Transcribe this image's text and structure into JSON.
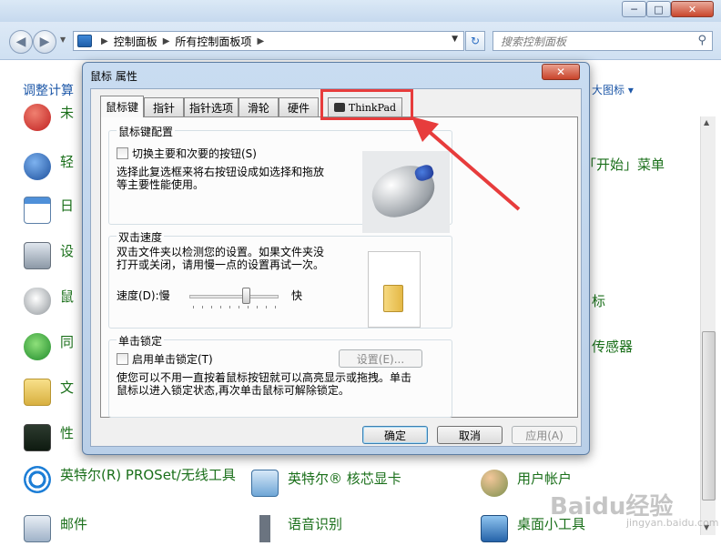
{
  "window": {
    "buttons": {
      "minimize": "─",
      "maximize": "□",
      "close": "✕"
    }
  },
  "addressbar": {
    "crumbs": [
      "控制面板",
      "所有控制面板项"
    ],
    "search_placeholder": "搜索控制面板"
  },
  "header": {
    "left": "调整计算",
    "right": "大图标 ▾"
  },
  "items": [
    {
      "label": "未",
      "icon": "red-circle-icon"
    },
    {
      "label": "轻",
      "icon": "accessibility-icon"
    },
    {
      "label": "日",
      "icon": "calendar-icon"
    },
    {
      "label": "设",
      "icon": "printer-icon"
    },
    {
      "label": "鼠",
      "icon": "mouse-icon"
    },
    {
      "label": "同",
      "icon": "sync-icon"
    },
    {
      "label": "文",
      "icon": "folder-options-icon"
    },
    {
      "label": "性",
      "icon": "performance-icon"
    },
    {
      "label": "英特尔(R) PROSet/无线工具",
      "icon": "wifi-icon"
    },
    {
      "label": "邮件",
      "icon": "mail-icon"
    }
  ],
  "items_mid": [
    {
      "label": "英特尔® 核芯显卡",
      "icon": "intel-graphics-icon"
    },
    {
      "label": "语音识别",
      "icon": "microphone-icon"
    }
  ],
  "items_right": [
    {
      "label": "「开始」菜单"
    },
    {
      "label": "标"
    },
    {
      "label": "传感器"
    },
    {
      "label": "用户帐户",
      "icon": "users-icon"
    },
    {
      "label": "桌面小工具",
      "icon": "gadgets-icon"
    }
  ],
  "dialog": {
    "title": "鼠标 属性",
    "close": "✕",
    "tabs": [
      "鼠标键",
      "指针",
      "指针选项",
      "滑轮",
      "硬件",
      "ThinkPad"
    ],
    "active_tab": "鼠标键",
    "buttons_config": {
      "title": "鼠标键配置",
      "checkbox": "切换主要和次要的按钮(S)",
      "desc_line1": "选择此复选框来将右按钮设成如选择和拖放",
      "desc_line2": "等主要性能使用。"
    },
    "double_click": {
      "title": "双击速度",
      "desc_line1": "双击文件夹以检测您的设置。如果文件夹没",
      "desc_line2": "打开或关闭，请用慢一点的设置再试一次。",
      "speed_label": "速度(D):慢",
      "fast_label": "快",
      "speed_value": 0.6
    },
    "click_lock": {
      "title": "单击锁定",
      "checkbox": "启用单击锁定(T)",
      "settings": "设置(E)...",
      "desc_line1": "使您可以不用一直按着鼠标按钮就可以高亮显示或拖拽。单击",
      "desc_line2": "鼠标以进入锁定状态,再次单击鼠标可解除锁定。"
    },
    "ok": "确定",
    "cancel": "取消",
    "apply": "应用(A)"
  },
  "watermark": {
    "main": "Baidu经验",
    "sub": "jingyan.baidu.com"
  },
  "colors": {
    "annotation": "#e73c3c",
    "link": "#1e58a8",
    "item_text": "#1a6f1a"
  }
}
